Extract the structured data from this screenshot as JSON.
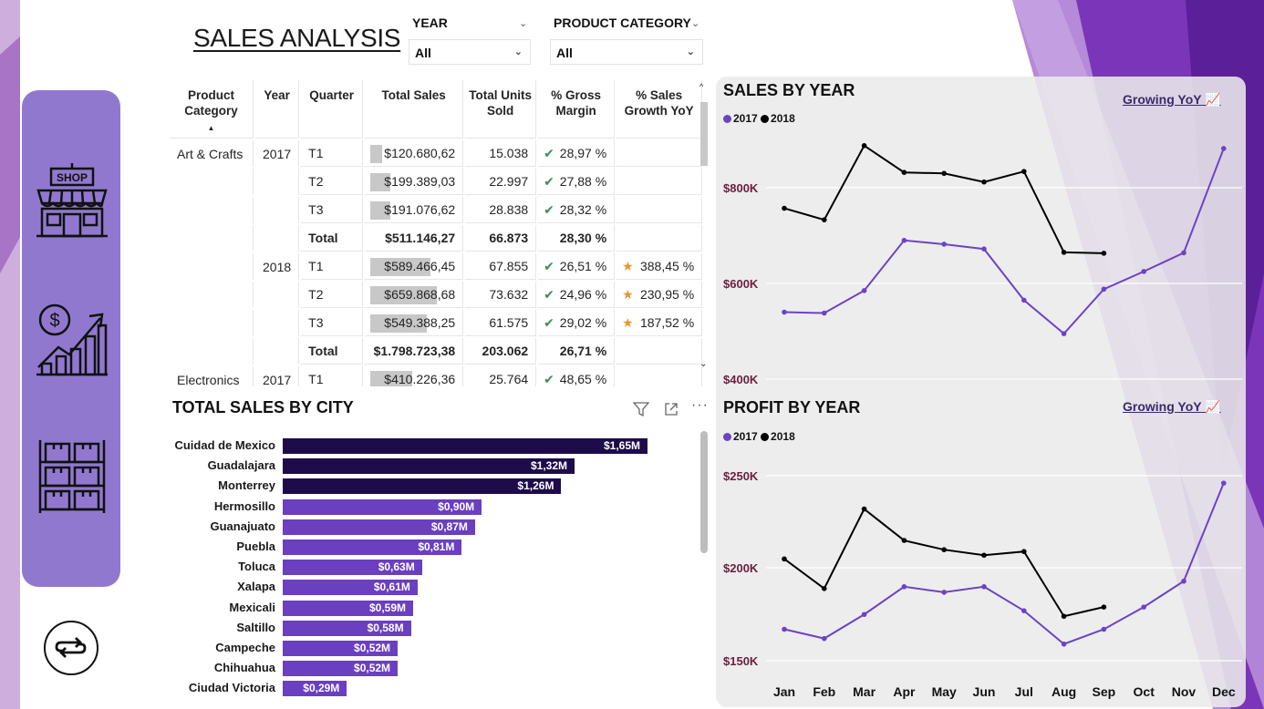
{
  "header": {
    "title": "SALES ANALYSIS",
    "year_slicer": {
      "label": "YEAR",
      "value": "All"
    },
    "category_slicer": {
      "label": "PRODUCT CATEGORY",
      "value": "All"
    }
  },
  "nav": {
    "icons": [
      "shop-icon",
      "sales-growth-icon",
      "warehouse-icon"
    ],
    "swap_icon": "swap-arrows-icon",
    "shop_sign": "SHOP"
  },
  "colors": {
    "nav_bg": "#9178cf",
    "series_2017": "#6a44c4",
    "series_2018": "#000000",
    "bar_dark": "#1e0b4a",
    "bar_mid": "#6a3fc0",
    "axis_label": "#6b1f3d"
  },
  "matrix": {
    "headers": [
      "Product Category",
      "Year",
      "Quarter",
      "Total Sales",
      "Total Units Sold",
      "% Gross Margin",
      "% Sales Growth YoY"
    ],
    "sort_indicator": "▲",
    "rows": [
      {
        "category": "Art & Crafts",
        "year": "2017",
        "quarter": "T1",
        "sales": "$120.680,62",
        "units": "15.038",
        "margin": "28,97 %",
        "growth": "",
        "bar": 0.06,
        "check": true,
        "star": false,
        "total": false
      },
      {
        "category": "",
        "year": "",
        "quarter": "T2",
        "sales": "$199.389,03",
        "units": "22.997",
        "margin": "27,88 %",
        "growth": "",
        "bar": 0.1,
        "check": true,
        "star": false,
        "total": false
      },
      {
        "category": "",
        "year": "",
        "quarter": "T3",
        "sales": "$191.076,62",
        "units": "28.838",
        "margin": "28,32 %",
        "growth": "",
        "bar": 0.1,
        "check": true,
        "star": false,
        "total": false
      },
      {
        "category": "",
        "year": "",
        "quarter": "Total",
        "sales": "$511.146,27",
        "units": "66.873",
        "margin": "28,30 %",
        "growth": "",
        "bar": 0,
        "check": false,
        "star": false,
        "total": true
      },
      {
        "category": "",
        "year": "2018",
        "quarter": "T1",
        "sales": "$589.466,45",
        "units": "67.855",
        "margin": "26,51 %",
        "growth": "388,45 %",
        "bar": 0.3,
        "check": true,
        "star": true,
        "total": false
      },
      {
        "category": "",
        "year": "",
        "quarter": "T2",
        "sales": "$659.868,68",
        "units": "73.632",
        "margin": "24,96 %",
        "growth": "230,95 %",
        "bar": 0.33,
        "check": true,
        "star": true,
        "total": false
      },
      {
        "category": "",
        "year": "",
        "quarter": "T3",
        "sales": "$549.388,25",
        "units": "61.575",
        "margin": "29,02 %",
        "growth": "187,52 %",
        "bar": 0.28,
        "check": true,
        "star": true,
        "total": false
      },
      {
        "category": "",
        "year": "",
        "quarter": "Total",
        "sales": "$1.798.723,38",
        "units": "203.062",
        "margin": "26,71 %",
        "growth": "",
        "bar": 0,
        "check": false,
        "star": false,
        "total": true
      },
      {
        "category": "Electronics",
        "year": "2017",
        "quarter": "T1",
        "sales": "$410.226,36",
        "units": "25.764",
        "margin": "48,65 %",
        "growth": "",
        "bar": 0.21,
        "check": true,
        "star": false,
        "total": false
      }
    ]
  },
  "city_chart": {
    "title": "TOTAL SALES BY CITY",
    "toolbar_icons": [
      "filter-icon",
      "focus-mode-icon",
      "more-options-icon"
    ],
    "chart_data": {
      "type": "bar",
      "orientation": "horizontal",
      "categories": [
        "Cuidad de Mexico",
        "Guadalajara",
        "Monterrey",
        "Hermosillo",
        "Guanajuato",
        "Puebla",
        "Toluca",
        "Xalapa",
        "Mexicali",
        "Saltillo",
        "Campeche",
        "Chihuahua",
        "Ciudad Victoria"
      ],
      "values": [
        1.65,
        1.32,
        1.26,
        0.9,
        0.87,
        0.81,
        0.63,
        0.61,
        0.59,
        0.58,
        0.52,
        0.52,
        0.29
      ],
      "labels": [
        "$1,65M",
        "$1,32M",
        "$1,26M",
        "$0,90M",
        "$0,87M",
        "$0,81M",
        "$0,63M",
        "$0,61M",
        "$0,59M",
        "$0,58M",
        "$0,52M",
        "$0,52M",
        "$0,29M"
      ],
      "xlim": [
        0,
        1.65
      ]
    }
  },
  "sales_chart": {
    "title": "SALES BY YEAR",
    "growing_label": "Growing YoY",
    "legend": [
      "2017",
      "2018"
    ],
    "yticks": [
      "$800K",
      "$600K",
      "$400K"
    ],
    "chart_data": {
      "type": "line",
      "x": [
        "Jan",
        "Feb",
        "Mar",
        "Apr",
        "May",
        "Jun",
        "Jul",
        "Aug",
        "Sep",
        "Oct",
        "Nov",
        "Dec"
      ],
      "series": [
        {
          "name": "2017",
          "values": [
            540,
            538,
            585,
            690,
            682,
            672,
            565,
            495,
            588,
            625,
            664,
            882
          ]
        },
        {
          "name": "2018",
          "values": [
            757,
            733,
            888,
            832,
            830,
            812,
            834,
            665,
            663
          ]
        }
      ],
      "ylim": [
        400,
        900
      ]
    }
  },
  "profit_chart": {
    "title": "PROFIT BY YEAR",
    "growing_label": "Growing YoY",
    "legend": [
      "2017",
      "2018"
    ],
    "yticks": [
      "$250K",
      "$200K",
      "$150K"
    ],
    "xticks": [
      "Jan",
      "Feb",
      "Mar",
      "Apr",
      "May",
      "Jun",
      "Jul",
      "Aug",
      "Sep",
      "Oct",
      "Nov",
      "Dec"
    ],
    "chart_data": {
      "type": "line",
      "x": [
        "Jan",
        "Feb",
        "Mar",
        "Apr",
        "May",
        "Jun",
        "Jul",
        "Aug",
        "Sep",
        "Oct",
        "Nov",
        "Dec"
      ],
      "series": [
        {
          "name": "2017",
          "values": [
            167,
            162,
            175,
            190,
            187,
            190,
            177,
            159,
            167,
            179,
            193,
            246
          ]
        },
        {
          "name": "2018",
          "values": [
            205,
            189,
            232,
            215,
            210,
            207,
            209,
            174,
            179
          ]
        }
      ],
      "ylim": [
        150,
        250
      ]
    }
  }
}
